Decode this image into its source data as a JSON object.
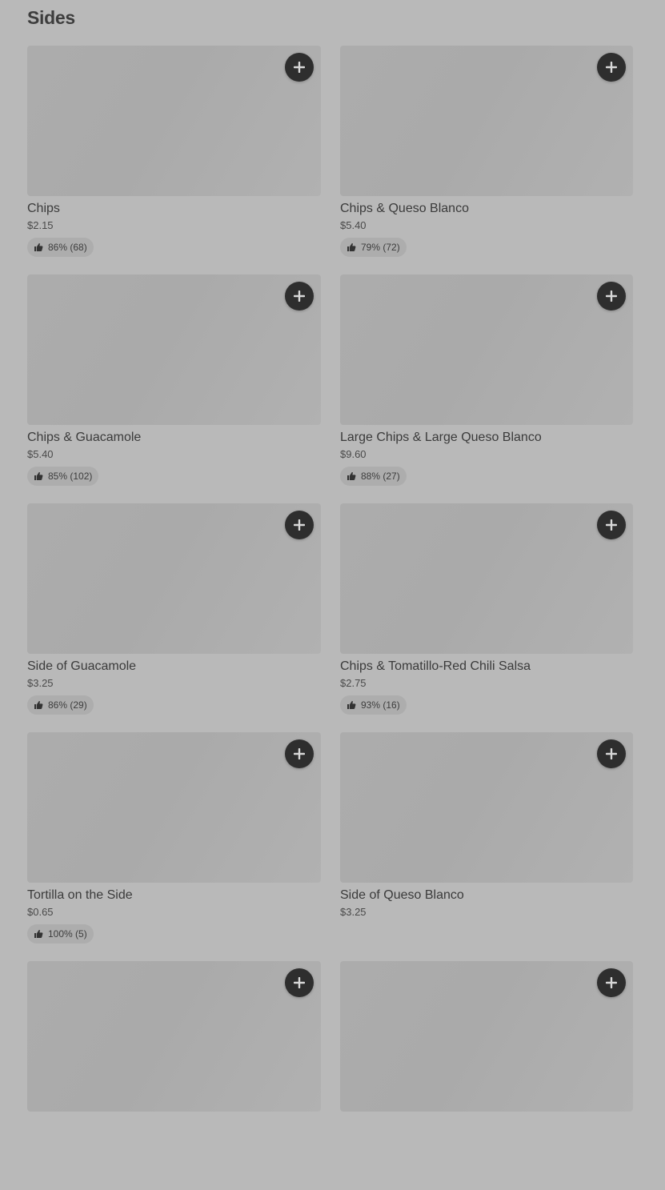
{
  "section": {
    "title": "Sides"
  },
  "items": [
    {
      "name": "Chips",
      "price": "$2.15",
      "rating": "86% (68)"
    },
    {
      "name": "Chips & Queso Blanco",
      "price": "$5.40",
      "rating": "79% (72)"
    },
    {
      "name": "Chips & Guacamole",
      "price": "$5.40",
      "rating": "85% (102)"
    },
    {
      "name": "Large Chips & Large Queso Blanco",
      "price": "$9.60",
      "rating": "88% (27)"
    },
    {
      "name": "Side of Guacamole",
      "price": "$3.25",
      "rating": "86% (29)"
    },
    {
      "name": "Chips & Tomatillo-Red Chili Salsa",
      "price": "$2.75",
      "rating": "93% (16)"
    },
    {
      "name": "Tortilla on the Side",
      "price": "$0.65",
      "rating": "100% (5)"
    },
    {
      "name": "Side of Queso Blanco",
      "price": "$3.25",
      "rating": null
    },
    {
      "name": "",
      "price": "",
      "rating": null
    },
    {
      "name": "",
      "price": "",
      "rating": null
    }
  ],
  "icons": {
    "add": "plus-icon",
    "rating": "thumbs-up-icon"
  },
  "colors": {
    "background": "#b9b9b9",
    "button": "#2e2e2e",
    "rating_pill": "#adadad"
  }
}
